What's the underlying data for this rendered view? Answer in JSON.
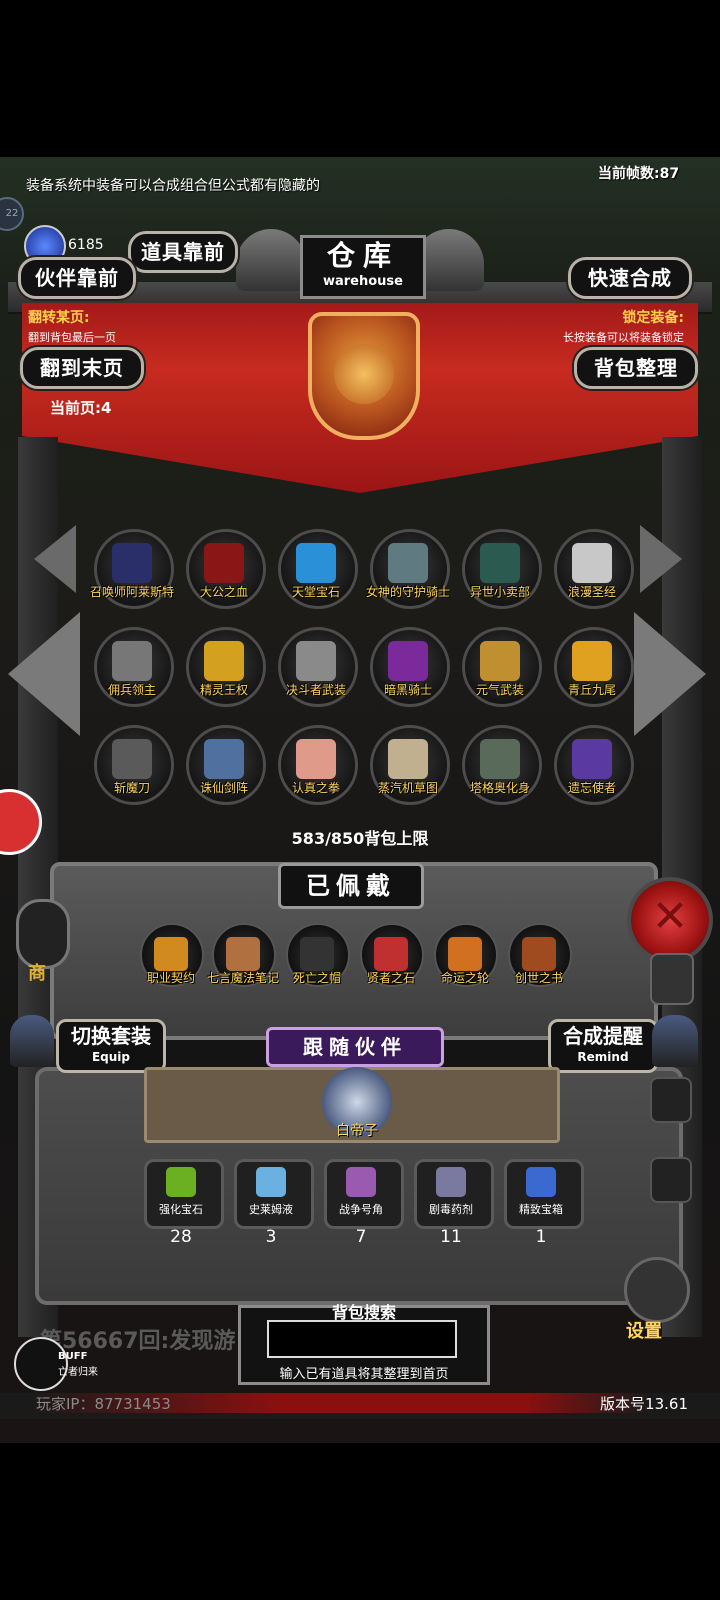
{
  "game": {
    "tip": "装备系统中装备可以合成组合但公式都有隐藏的",
    "fps": "当前帧数:87",
    "badge_num": "22",
    "gems": "6185",
    "title_cn": "仓库",
    "title_en": "warehouse",
    "buttons": {
      "items_front": "道具靠前",
      "partner_front": "伙伴靠前",
      "quick_combine": "快速合成",
      "goto_last": "翻到末页",
      "bag_sort": "背包整理"
    },
    "page_jump_title": "翻转某页:",
    "page_jump_desc": "翻到背包最后一页",
    "lock_title": "锁定装备:",
    "lock_desc": "长按装备可以将装备锁定",
    "current_page": "当前页:4",
    "items": [
      {
        "label": "召唤师阿莱斯特",
        "color": "#2a2f6a"
      },
      {
        "label": "大公之血",
        "color": "#8a1616"
      },
      {
        "label": "天堂宝石",
        "color": "#2a90d8"
      },
      {
        "label": "女神的守护骑士",
        "color": "#5f7a80"
      },
      {
        "label": "异世小卖部",
        "color": "#2b5a50"
      },
      {
        "label": "浪漫圣经",
        "color": "#c8c8c8"
      },
      {
        "label": "佣兵领主",
        "color": "#777777"
      },
      {
        "label": "精灵王权",
        "color": "#d4a020"
      },
      {
        "label": "决斗者武装",
        "color": "#8a8a8a"
      },
      {
        "label": "暗黑骑士",
        "color": "#7a2a9a"
      },
      {
        "label": "元气武装",
        "color": "#c09030"
      },
      {
        "label": "青丘九尾",
        "color": "#e0a020"
      },
      {
        "label": "斩魔刀",
        "color": "#5a5a5a"
      },
      {
        "label": "诛仙剑阵",
        "color": "#5070a0"
      },
      {
        "label": "认真之拳",
        "color": "#e09a8a"
      },
      {
        "label": "蒸汽机草图",
        "color": "#c0b090"
      },
      {
        "label": "塔格奥化身",
        "color": "#5a6a5a"
      },
      {
        "label": "遗忘使者",
        "color": "#5a3aa0"
      }
    ],
    "capacity": "583/850背包上限",
    "equipped_title": "已佩戴",
    "equipped": [
      {
        "label": "职业契约",
        "color": "#d08a20"
      },
      {
        "label": "七言魔法笔记",
        "color": "#b07040"
      },
      {
        "label": "死亡之帽",
        "color": "#333333"
      },
      {
        "label": "贤者之石",
        "color": "#c03030"
      },
      {
        "label": "命运之轮",
        "color": "#d07020"
      },
      {
        "label": "创世之书",
        "color": "#a04a20"
      }
    ],
    "switch_set": {
      "cn": "切换套装",
      "en": "Equip"
    },
    "combine_remind": {
      "cn": "合成提醒",
      "en": "Remind"
    },
    "follow_title": "跟随伙伴",
    "partner_name": "白帝子",
    "slots": [
      {
        "label": "强化宝石",
        "count": "28",
        "color": "#6ab020"
      },
      {
        "label": "史莱姆液",
        "count": "3",
        "color": "#6ab0e0"
      },
      {
        "label": "战争号角",
        "count": "7",
        "color": "#9a5ab0"
      },
      {
        "label": "剧毒药剂",
        "count": "11",
        "color": "#7a7aa0"
      },
      {
        "label": "精致宝箱",
        "count": "1",
        "color": "#3a6ad0"
      }
    ],
    "shop_label": "商",
    "search_title": "背包搜索",
    "search_value": "",
    "search_hint": "输入已有道具将其整理到首页",
    "chat_text": "第56667回:发现游",
    "buff_label": "BUFF",
    "buff_sub": "亡者归来",
    "settings_label": "设置",
    "player_ip": "玩家IP：87731453",
    "version": "版本号13.61"
  }
}
